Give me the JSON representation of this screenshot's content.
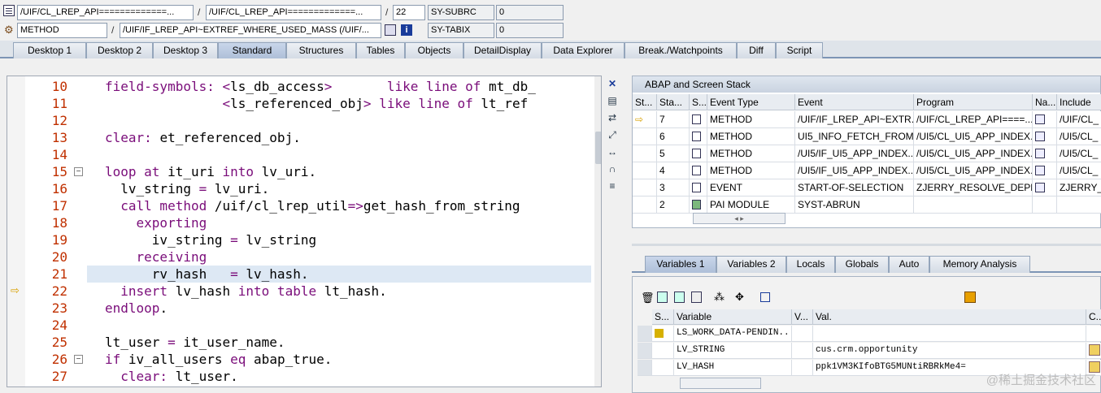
{
  "top": {
    "row1": {
      "class_field": "/UIF/CL_LREP_API=============...",
      "sep1": "/",
      "class_field2": "/UIF/CL_LREP_API=============...",
      "sep2": "/",
      "line": "22",
      "var_name": "SY-SUBRC",
      "var_value": "0"
    },
    "row2": {
      "type_field": "METHOD",
      "sep1": "/",
      "method_field": "/UIF/IF_LREP_API~EXTREF_WHERE_USED_MASS (/UIF/...",
      "var_name": "SY-TABIX",
      "var_value": "0"
    }
  },
  "tabs": [
    "Desktop 1",
    "Desktop 2",
    "Desktop 3",
    "Standard",
    "Structures",
    "Tables",
    "Objects",
    "DetailDisplay",
    "Data Explorer",
    "Break./Watchpoints",
    "Diff",
    "Script"
  ],
  "active_tab": "Standard",
  "code": {
    "line_numbers": [
      "10",
      "11",
      "12",
      "13",
      "14",
      "15",
      "16",
      "17",
      "18",
      "19",
      "20",
      "21",
      "22",
      "23",
      "24",
      "25",
      "26",
      "27"
    ],
    "lines": [
      [
        [
          "kw",
          "field-symbols: "
        ],
        [
          "kw",
          "<"
        ],
        [
          "",
          "ls_db_access"
        ],
        [
          "kw",
          ">"
        ],
        [
          "",
          "       "
        ],
        [
          "kw",
          "like line of "
        ],
        [
          "",
          "mt_db_"
        ]
      ],
      [
        [
          "",
          "               "
        ],
        [
          "kw",
          "<"
        ],
        [
          "",
          "ls_referenced_obj"
        ],
        [
          "kw",
          ">"
        ],
        [
          "kw",
          " like line of "
        ],
        [
          "",
          "lt_ref"
        ]
      ],
      [
        [
          "",
          ""
        ]
      ],
      [
        [
          "kw",
          "clear: "
        ],
        [
          "",
          "et_referenced_obj."
        ]
      ],
      [
        [
          "",
          ""
        ]
      ],
      [
        [
          "kw",
          "loop at "
        ],
        [
          "",
          "it_uri "
        ],
        [
          "kw",
          "into "
        ],
        [
          "",
          "lv_uri."
        ]
      ],
      [
        [
          "",
          "  lv_string "
        ],
        [
          "kw",
          "= "
        ],
        [
          "",
          "lv_uri."
        ]
      ],
      [
        [
          "kw",
          "  call method "
        ],
        [
          "",
          "/uif/cl_lrep_util"
        ],
        [
          "kw",
          "=>"
        ],
        [
          "",
          "get_hash_from_string"
        ]
      ],
      [
        [
          "kw",
          "    exporting"
        ]
      ],
      [
        [
          "",
          "      iv_string "
        ],
        [
          "kw",
          "= "
        ],
        [
          "",
          "lv_string"
        ]
      ],
      [
        [
          "kw",
          "    receiving"
        ]
      ],
      [
        [
          "",
          "      rv_hash   "
        ],
        [
          "kw",
          "= "
        ],
        [
          "",
          "lv_hash."
        ]
      ],
      [
        [
          "kw",
          "  insert "
        ],
        [
          "",
          "lv_hash "
        ],
        [
          "kw",
          "into table "
        ],
        [
          "",
          "lt_hash."
        ]
      ],
      [
        [
          "kw",
          "endloop"
        ],
        [
          "",
          "."
        ]
      ],
      [
        [
          "",
          ""
        ]
      ],
      [
        [
          "",
          "lt_user "
        ],
        [
          "kw",
          "= "
        ],
        [
          "",
          "it_user_name."
        ]
      ],
      [
        [
          "kw",
          "if "
        ],
        [
          "",
          "iv_all_users "
        ],
        [
          "kw",
          "eq "
        ],
        [
          "",
          "abap_true."
        ]
      ],
      [
        [
          "kw",
          "  clear: "
        ],
        [
          "",
          "lt_user."
        ]
      ]
    ]
  },
  "stack": {
    "title": "ABAP and Screen Stack",
    "headers": [
      "St...",
      "Sta...",
      "S...",
      "Event Type",
      "Event",
      "Program",
      "Na...",
      "Include"
    ],
    "rows": [
      {
        "level": "7",
        "type": "METHOD",
        "event": "/UIF/IF_LREP_API~EXTR...",
        "program": "/UIF/CL_LREP_API====...",
        "include": "/UIF/CL_",
        "current": true
      },
      {
        "level": "6",
        "type": "METHOD",
        "event": "UI5_INFO_FETCH_FROM...",
        "program": "/UI5/CL_UI5_APP_INDEX...",
        "include": "/UI5/CL_",
        "current": false
      },
      {
        "level": "5",
        "type": "METHOD",
        "event": "/UI5/IF_UI5_APP_INDEX...",
        "program": "/UI5/CL_UI5_APP_INDEX...",
        "include": "/UI5/CL_",
        "current": false
      },
      {
        "level": "4",
        "type": "METHOD",
        "event": "/UI5/IF_UI5_APP_INDEX...",
        "program": "/UI5/CL_UI5_APP_INDEX...",
        "include": "/UI5/CL_",
        "current": false
      },
      {
        "level": "3",
        "type": "EVENT",
        "event": "START-OF-SELECTION",
        "program": "ZJERRY_RESOLVE_DEPE...",
        "include": "ZJERRY_R",
        "current": false
      },
      {
        "level": "2",
        "type": "PAI MODULE",
        "event": "SYST-ABRUN",
        "program": "",
        "include": "",
        "current": false
      }
    ]
  },
  "var_tabs": [
    "Variables 1",
    "Variables 2",
    "Locals",
    "Globals",
    "Auto",
    "Memory Analysis"
  ],
  "active_var_tab": "Variables 1",
  "variables": {
    "headers": [
      "S...",
      "Variable",
      "V...",
      "Val.",
      "C..."
    ],
    "rows": [
      {
        "name": "LS_WORK_DATA-PENDIN...",
        "value": "",
        "icon": true
      },
      {
        "name": "LV_STRING",
        "value": "cus.crm.opportunity",
        "icon": false
      },
      {
        "name": "LV_HASH",
        "value": "ppk1VM3KIfoBTG5MUNtiRBRkMe4=",
        "icon": false
      }
    ]
  },
  "watermark": "@稀土掘金技术社区"
}
